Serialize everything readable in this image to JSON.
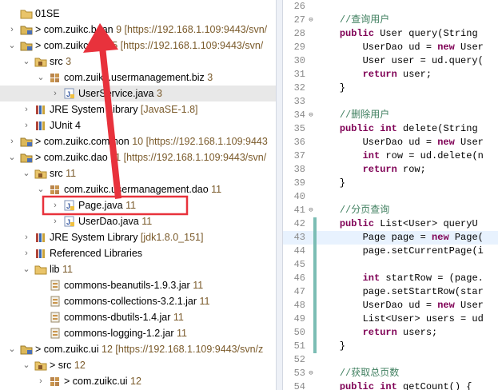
{
  "explorer": {
    "rows": [
      {
        "arrow": "",
        "indent": 0,
        "icon": "folder-icon",
        "label": "01SE",
        "extra": ""
      },
      {
        "arrow": "›",
        "indent": 0,
        "icon": "project-icon",
        "label": "> com.zuikc.bean",
        "extra": " 9 [https://192.168.1.109:9443/svn/"
      },
      {
        "arrow": "⌄",
        "indent": 0,
        "icon": "project-icon",
        "label": "> com.zuikc.biz",
        "extra": " 15 [https://192.168.1.109:9443/svn/"
      },
      {
        "arrow": "⌄",
        "indent": 1,
        "icon": "source-folder-icon",
        "label": "src",
        "extra": " 3"
      },
      {
        "arrow": "⌄",
        "indent": 2,
        "icon": "package-icon",
        "label": "com.zuikc.usermanagement.biz",
        "extra": " 3"
      },
      {
        "arrow": "›",
        "indent": 3,
        "icon": "java-file-icon",
        "label": "UserService.java",
        "extra": " 3",
        "sel": true
      },
      {
        "arrow": "›",
        "indent": 1,
        "icon": "library-icon",
        "label": "JRE System Library",
        "extra": " [JavaSE-1.8]"
      },
      {
        "arrow": "›",
        "indent": 1,
        "icon": "library-icon",
        "label": "JUnit 4",
        "extra": ""
      },
      {
        "arrow": "›",
        "indent": 0,
        "icon": "project-icon",
        "label": "> com.zuikc.common",
        "extra": " 10 [https://192.168.1.109:9443"
      },
      {
        "arrow": "⌄",
        "indent": 0,
        "icon": "project-icon",
        "label": "> com.zuikc.dao",
        "extra": " 11 [https://192.168.1.109:9443/svn/"
      },
      {
        "arrow": "⌄",
        "indent": 1,
        "icon": "source-folder-icon",
        "label": "src",
        "extra": " 11"
      },
      {
        "arrow": "⌄",
        "indent": 2,
        "icon": "package-icon",
        "label": "com.zuikc.usermanagement.dao",
        "extra": " 11"
      },
      {
        "arrow": "›",
        "indent": 3,
        "icon": "java-file-icon",
        "label": "Page.java",
        "extra": " 11"
      },
      {
        "arrow": "›",
        "indent": 3,
        "icon": "java-file-icon",
        "label": "UserDao.java",
        "extra": " 11"
      },
      {
        "arrow": "›",
        "indent": 1,
        "icon": "library-icon",
        "label": "JRE System Library",
        "extra": " [jdk1.8.0_151]"
      },
      {
        "arrow": "›",
        "indent": 1,
        "icon": "library-icon",
        "label": "Referenced Libraries",
        "extra": ""
      },
      {
        "arrow": "⌄",
        "indent": 1,
        "icon": "folder-icon",
        "label": "lib",
        "extra": " 11"
      },
      {
        "arrow": "",
        "indent": 2,
        "icon": "jar-icon",
        "label": "commons-beanutils-1.9.3.jar",
        "extra": " 11"
      },
      {
        "arrow": "",
        "indent": 2,
        "icon": "jar-icon",
        "label": "commons-collections-3.2.1.jar",
        "extra": " 11"
      },
      {
        "arrow": "",
        "indent": 2,
        "icon": "jar-icon",
        "label": "commons-dbutils-1.4.jar",
        "extra": " 11"
      },
      {
        "arrow": "",
        "indent": 2,
        "icon": "jar-icon",
        "label": "commons-logging-1.2.jar",
        "extra": " 11"
      },
      {
        "arrow": "⌄",
        "indent": 0,
        "icon": "project-icon",
        "label": "> com.zuikc.ui",
        "extra": " 12 [https://192.168.1.109:9443/svn/z"
      },
      {
        "arrow": "⌄",
        "indent": 1,
        "icon": "source-folder-icon",
        "label": "> src",
        "extra": " 12"
      },
      {
        "arrow": "›",
        "indent": 2,
        "icon": "package-icon",
        "label": "> com.zuikc.ui",
        "extra": " 12"
      }
    ]
  },
  "editor": {
    "lines": [
      {
        "n": "26",
        "fold": "",
        "parts": []
      },
      {
        "n": "27",
        "fold": "⊖",
        "parts": [
          {
            "t": "    ",
            "c": ""
          },
          {
            "t": "//查询用户",
            "c": "cm"
          }
        ]
      },
      {
        "n": "28",
        "fold": "",
        "parts": [
          {
            "t": "    ",
            "c": ""
          },
          {
            "t": "public",
            "c": "kw"
          },
          {
            "t": " User query(String ",
            "c": ""
          }
        ]
      },
      {
        "n": "29",
        "fold": "",
        "parts": [
          {
            "t": "        UserDao ud = ",
            "c": ""
          },
          {
            "t": "new",
            "c": "kw"
          },
          {
            "t": " User",
            "c": ""
          }
        ]
      },
      {
        "n": "30",
        "fold": "",
        "parts": [
          {
            "t": "        User user = ud.query(",
            "c": ""
          }
        ]
      },
      {
        "n": "31",
        "fold": "",
        "parts": [
          {
            "t": "        ",
            "c": ""
          },
          {
            "t": "return",
            "c": "kw"
          },
          {
            "t": " user;",
            "c": ""
          }
        ]
      },
      {
        "n": "32",
        "fold": "",
        "parts": [
          {
            "t": "    }",
            "c": ""
          }
        ]
      },
      {
        "n": "33",
        "fold": "",
        "parts": []
      },
      {
        "n": "34",
        "fold": "⊖",
        "parts": [
          {
            "t": "    ",
            "c": ""
          },
          {
            "t": "//删除用户",
            "c": "cm"
          }
        ]
      },
      {
        "n": "35",
        "fold": "",
        "parts": [
          {
            "t": "    ",
            "c": ""
          },
          {
            "t": "public",
            "c": "kw"
          },
          {
            "t": " ",
            "c": ""
          },
          {
            "t": "int",
            "c": "kw"
          },
          {
            "t": " delete(String ",
            "c": ""
          }
        ]
      },
      {
        "n": "36",
        "fold": "",
        "parts": [
          {
            "t": "        UserDao ud = ",
            "c": ""
          },
          {
            "t": "new",
            "c": "kw"
          },
          {
            "t": " User",
            "c": ""
          }
        ]
      },
      {
        "n": "37",
        "fold": "",
        "parts": [
          {
            "t": "        ",
            "c": ""
          },
          {
            "t": "int",
            "c": "kw"
          },
          {
            "t": " row = ud.delete(n",
            "c": ""
          }
        ]
      },
      {
        "n": "38",
        "fold": "",
        "parts": [
          {
            "t": "        ",
            "c": ""
          },
          {
            "t": "return",
            "c": "kw"
          },
          {
            "t": " row;",
            "c": ""
          }
        ]
      },
      {
        "n": "39",
        "fold": "",
        "parts": [
          {
            "t": "    }",
            "c": ""
          }
        ]
      },
      {
        "n": "40",
        "fold": "",
        "parts": []
      },
      {
        "n": "41",
        "fold": "⊖",
        "parts": [
          {
            "t": "    ",
            "c": ""
          },
          {
            "t": "//分页查询",
            "c": "cm"
          }
        ]
      },
      {
        "n": "42",
        "fold": "",
        "parts": [
          {
            "t": "    ",
            "c": ""
          },
          {
            "t": "public",
            "c": "kw"
          },
          {
            "t": " List<User> queryU",
            "c": ""
          }
        ]
      },
      {
        "n": "43",
        "fold": "",
        "hl": true,
        "parts": [
          {
            "t": "        Page ",
            "c": ""
          },
          {
            "t": "page",
            "c": ""
          },
          {
            "t": " = ",
            "c": ""
          },
          {
            "t": "new",
            "c": "kw"
          },
          {
            "t": " Page(",
            "c": ""
          }
        ]
      },
      {
        "n": "44",
        "fold": "",
        "parts": [
          {
            "t": "        ",
            "c": ""
          },
          {
            "t": "page",
            "c": ""
          },
          {
            "t": ".setCurrentPage(i",
            "c": ""
          }
        ]
      },
      {
        "n": "45",
        "fold": "",
        "parts": []
      },
      {
        "n": "46",
        "fold": "",
        "parts": [
          {
            "t": "        ",
            "c": ""
          },
          {
            "t": "int",
            "c": "kw"
          },
          {
            "t": " startRow = (page.",
            "c": ""
          }
        ]
      },
      {
        "n": "47",
        "fold": "",
        "parts": [
          {
            "t": "        page.setStartRow(star",
            "c": ""
          }
        ]
      },
      {
        "n": "48",
        "fold": "",
        "parts": [
          {
            "t": "        UserDao ud = ",
            "c": ""
          },
          {
            "t": "new",
            "c": "kw"
          },
          {
            "t": " User",
            "c": ""
          }
        ]
      },
      {
        "n": "49",
        "fold": "",
        "parts": [
          {
            "t": "        List<User> users = ud",
            "c": ""
          }
        ]
      },
      {
        "n": "50",
        "fold": "",
        "parts": [
          {
            "t": "        ",
            "c": ""
          },
          {
            "t": "return",
            "c": "kw"
          },
          {
            "t": " users;",
            "c": ""
          }
        ]
      },
      {
        "n": "51",
        "fold": "",
        "parts": [
          {
            "t": "    }",
            "c": ""
          }
        ]
      },
      {
        "n": "52",
        "fold": "",
        "parts": []
      },
      {
        "n": "53",
        "fold": "⊖",
        "parts": [
          {
            "t": "    ",
            "c": ""
          },
          {
            "t": "//获取总页数",
            "c": "cm"
          }
        ]
      },
      {
        "n": "54",
        "fold": "",
        "parts": [
          {
            "t": "    ",
            "c": ""
          },
          {
            "t": "public",
            "c": "kw"
          },
          {
            "t": " ",
            "c": ""
          },
          {
            "t": "int",
            "c": "kw"
          },
          {
            "t": " getCount() {",
            "c": ""
          }
        ]
      }
    ]
  },
  "annotation": {
    "highlight_color": "#e8323c"
  }
}
